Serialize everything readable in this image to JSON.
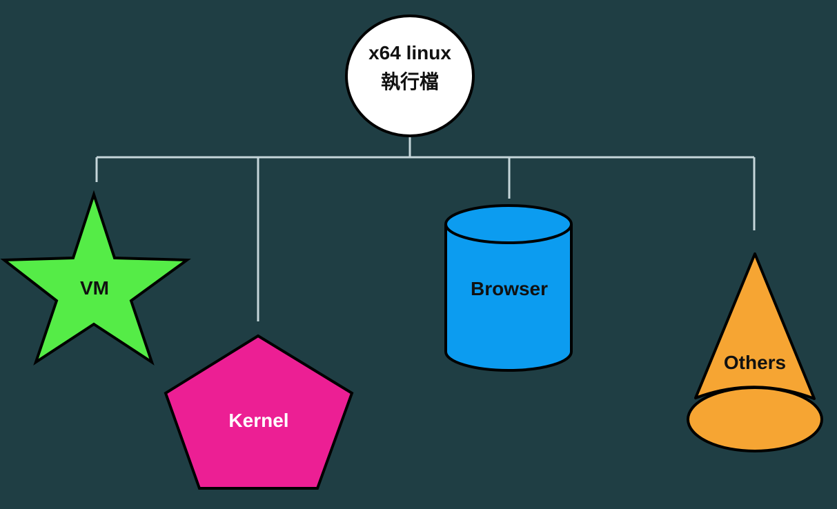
{
  "root": {
    "line1": "x64 linux",
    "line2": "執行檔"
  },
  "children": [
    {
      "label": "VM",
      "shape": "star",
      "color": "#55ec47"
    },
    {
      "label": "Kernel",
      "shape": "pentagon",
      "color": "#ec1f94"
    },
    {
      "label": "Browser",
      "shape": "cylinder",
      "color": "#0c9cf0"
    },
    {
      "label": "Others",
      "shape": "cone",
      "color": "#f6a533"
    }
  ],
  "colors": {
    "background": "#1f3e44",
    "connector": "#c5d6da"
  }
}
